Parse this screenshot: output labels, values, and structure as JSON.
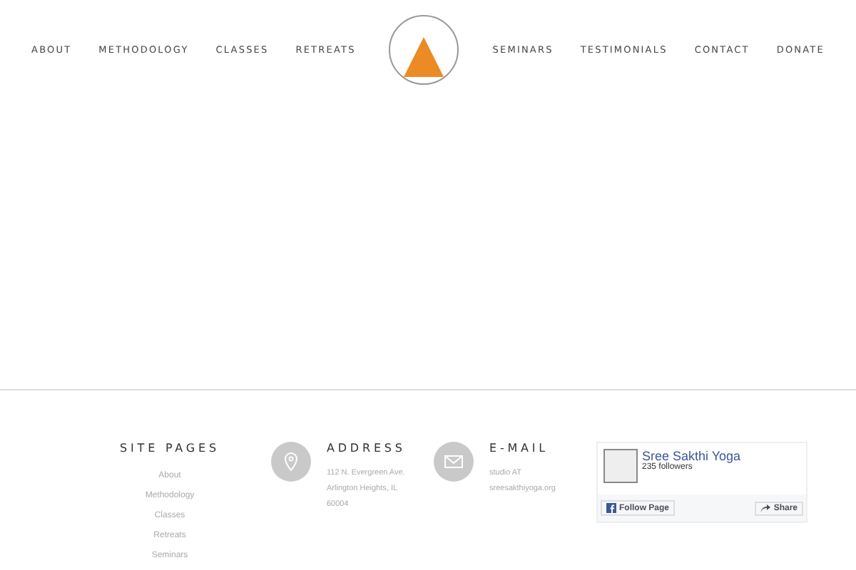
{
  "nav_left": [
    "ABOUT",
    "METHODOLOGY",
    "CLASSES",
    "RETREATS"
  ],
  "nav_right": [
    "SEMINARS",
    "TESTIMONIALS",
    "CONTACT",
    "DONATE"
  ],
  "site_pages": {
    "title": "SITE PAGES",
    "links": [
      "About",
      "Methodology",
      "Classes",
      "Retreats",
      "Seminars"
    ]
  },
  "address": {
    "title": "ADDRESS",
    "lines": [
      "112 N. Evergreen Ave.",
      "Arlington Heights, IL",
      "60004"
    ]
  },
  "email": {
    "title": "E-MAIL",
    "lines": [
      "studio AT",
      "sreesakthiyoga.org"
    ]
  },
  "facebook": {
    "page_name": "Sree Sakthi Yoga",
    "followers": "235 followers",
    "follow_button": "Follow Page",
    "share_button": "Share"
  }
}
